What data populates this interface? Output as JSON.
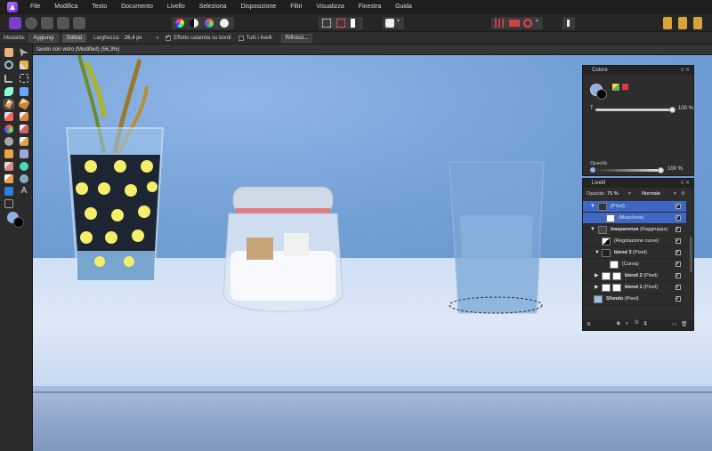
{
  "menu": [
    "File",
    "Modifica",
    "Testo",
    "Documento",
    "Livello",
    "Seleziona",
    "Disposizione",
    "Filtri",
    "Visualizza",
    "Finestra",
    "Guida"
  ],
  "context": {
    "mode_label": "Modalità:",
    "add_label": "Aggiungi",
    "subtract_label": "Sottrai",
    "width_label": "Larghezza:",
    "width_value": "26,4 px",
    "snap_label": "Effetto calamita su bordi",
    "all_layers_label": "Tutti i livelli",
    "refine_label": "Rifinisci..."
  },
  "document": {
    "title": "tavolo con vetro (Modified) (56,3%)"
  },
  "color_panel": {
    "title": "Colore",
    "t_label": "T",
    "t_value": "100 %",
    "opacity_label": "Opacità",
    "opacity_value": "100 %",
    "colors": {
      "primary": "#8fb0e6",
      "secondary": "#000000",
      "accent": "#e53935"
    }
  },
  "layers_panel": {
    "title": "Livelli",
    "opacity_label": "Opacità:",
    "opacity_value": "75 %",
    "blend_mode": "Normale",
    "rows": [
      {
        "name": "(Pixel)",
        "bold": "",
        "selected": true
      },
      {
        "name": "(Maschera)",
        "bold": "",
        "selected": true
      },
      {
        "name": " (Raggruppa)",
        "bold": "trasparenza",
        "selected": false
      },
      {
        "name": "(Regolazione curve)",
        "bold": "",
        "selected": false
      },
      {
        "name": " (Pixel)",
        "bold": "blend 3",
        "selected": false
      },
      {
        "name": "(Curva)",
        "bold": "",
        "selected": false
      },
      {
        "name": " (Pixel)",
        "bold": "blend 2",
        "selected": false
      },
      {
        "name": " (Pixel)",
        "bold": "blend 1",
        "selected": false
      },
      {
        "name": " (Pixel)",
        "bold": "Sfondo",
        "selected": false
      }
    ]
  }
}
